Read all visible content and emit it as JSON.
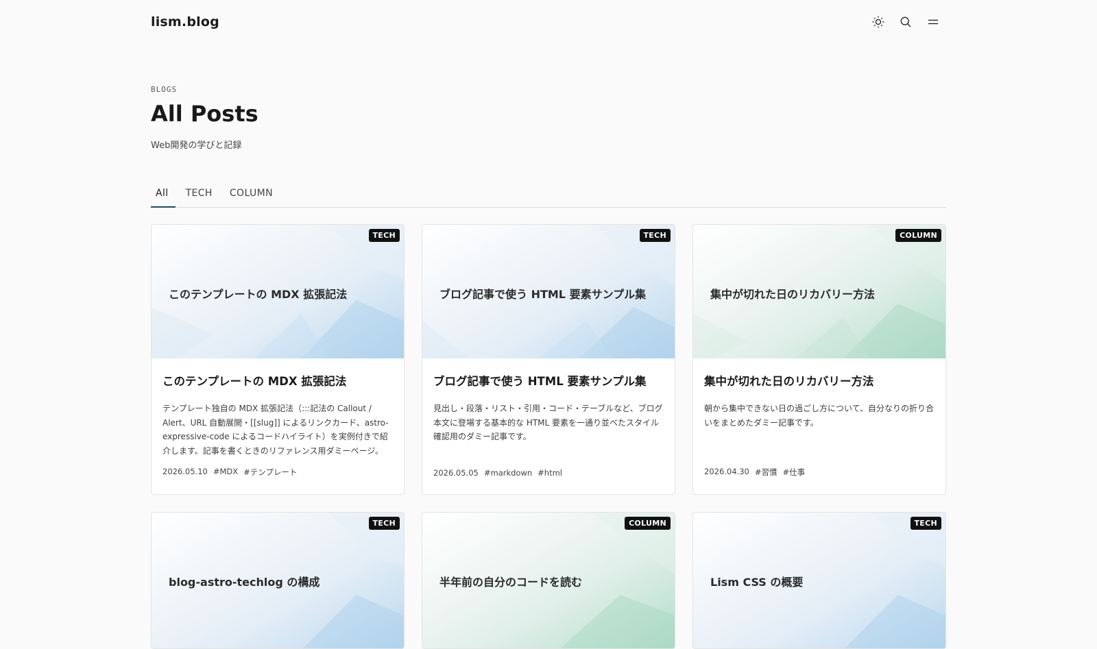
{
  "header": {
    "logo": "lism.blog",
    "icons": [
      "sun-icon",
      "search-icon",
      "menu-icon"
    ]
  },
  "hero": {
    "eyebrow": "BLOGS",
    "title": "All Posts",
    "subtitle": "Web開発の学びと記録"
  },
  "tabs": [
    {
      "label": "All",
      "active": true
    },
    {
      "label": "TECH",
      "active": false
    },
    {
      "label": "COLUMN",
      "active": false
    }
  ],
  "posts": [
    {
      "category": "TECH",
      "title": "このテンプレートの MDX 拡張記法",
      "excerpt": "テンプレート独自の MDX 拡張記法（:::記法の Callout / Alert、URL 自動展開・[[slug]] によるリンクカード、astro-expressive-code によるコードハイライト）を実例付きで紹介します。記事を書くときのリファレンス用ダミーページ。",
      "date": "2026.05.10",
      "tags": [
        "#MDX",
        "#テンプレート"
      ]
    },
    {
      "category": "TECH",
      "title": "ブログ記事で使う HTML 要素サンプル集",
      "excerpt": "見出し・段落・リスト・引用・コード・テーブルなど、ブログ本文に登場する基本的な HTML 要素を一通り並べたスタイル確認用のダミー記事です。",
      "date": "2026.05.05",
      "tags": [
        "#markdown",
        "#html"
      ]
    },
    {
      "category": "COLUMN",
      "title": "集中が切れた日のリカバリー方法",
      "excerpt": "朝から集中できない日の過ごし方について、自分なりの折り合いをまとめたダミー記事です。",
      "date": "2026.04.30",
      "tags": [
        "#習慣",
        "#仕事"
      ]
    },
    {
      "category": "TECH",
      "title": "blog-astro-techlog の構成"
    },
    {
      "category": "COLUMN",
      "title": "半年前の自分のコードを読む"
    },
    {
      "category": "TECH",
      "title": "Lism CSS の概要"
    }
  ]
}
